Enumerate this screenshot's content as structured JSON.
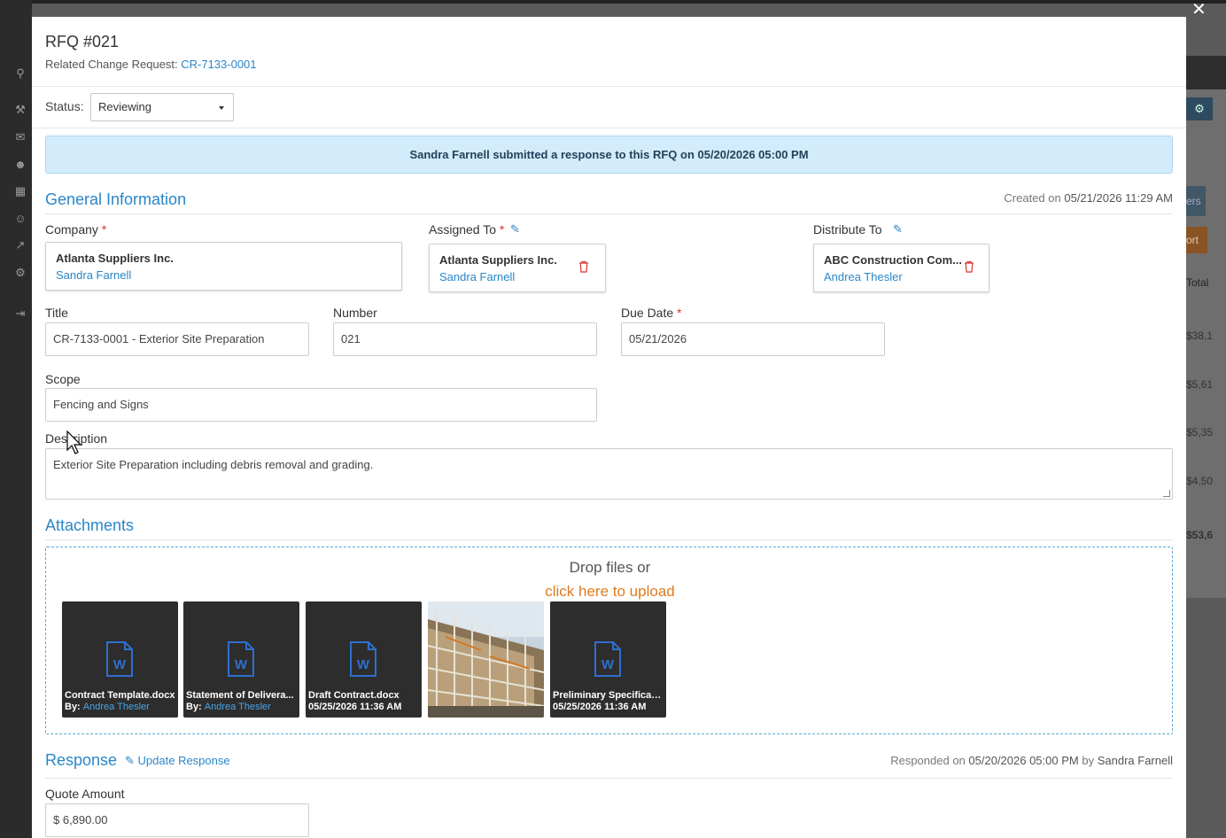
{
  "background": {
    "sidebar_icons": [
      "map-pin-icon",
      "hammer-icon",
      "mail-icon",
      "users-icon",
      "calendar-icon",
      "contacts-icon",
      "chart-icon",
      "gear-icon",
      "logout-icon"
    ],
    "right_fragments": {
      "button_partial_1": "ers",
      "button_partial_2": "ort",
      "column_header_partial": "Total",
      "cells": [
        "$38,1",
        "$5,61",
        "$5,35",
        "$4,50",
        "$53,6"
      ]
    }
  },
  "modal": {
    "title": "RFQ #021",
    "related_label": "Related Change Request:",
    "related_link": "CR-7133-0001",
    "status": {
      "label": "Status:",
      "value": "Reviewing"
    },
    "banner": "Sandra Farnell submitted a response to this RFQ on 05/20/2026 05:00 PM",
    "general": {
      "title": "General Information",
      "created_prefix": "Created on",
      "created_value": "05/21/2026 11:29 AM",
      "company": {
        "label": "Company",
        "required": "*",
        "name": "Atlanta Suppliers Inc.",
        "contact": "Sandra Farnell"
      },
      "assigned_to": {
        "label": "Assigned To",
        "required": "*",
        "name": "Atlanta Suppliers Inc.",
        "contact": "Sandra Farnell"
      },
      "distribute_to": {
        "label": "Distribute To",
        "name": "ABC Construction Com...",
        "contact": "Andrea Thesler"
      },
      "title_field": {
        "label": "Title",
        "value": "CR-7133-0001 - Exterior Site Preparation"
      },
      "number": {
        "label": "Number",
        "value": "021"
      },
      "due_date": {
        "label": "Due Date",
        "required": "*",
        "value": "05/21/2026"
      },
      "scope": {
        "label": "Scope",
        "value": "Fencing and Signs"
      },
      "description": {
        "label": "Description",
        "value": "Exterior Site Preparation including debris removal and grading."
      }
    },
    "attachments": {
      "title": "Attachments",
      "drop_text": "Drop files or",
      "upload_link": "click here to upload",
      "files": [
        {
          "name": "Contract Template.docx",
          "by_label": "By:",
          "by": "Andrea Thesler",
          "type": "word-doc-icon"
        },
        {
          "name": "Statement of Delivera...",
          "by_label": "By:",
          "by": "Andrea Thesler",
          "type": "word-doc-icon"
        },
        {
          "name": "Draft Contract.docx",
          "date": "05/25/2026 11:36 AM",
          "type": "word-doc-icon"
        },
        {
          "name": "",
          "type": "construction-photo"
        },
        {
          "name": "Preliminary Specificati...",
          "date": "05/25/2026 11:36 AM",
          "type": "word-doc-icon"
        }
      ]
    },
    "response": {
      "title": "Response",
      "update_label": "Update Response",
      "responded_prefix": "Responded on",
      "responded_date": "05/20/2026 05:00 PM",
      "by_label": "by",
      "responded_by": "Sandra Farnell",
      "quote_label": "Quote Amount",
      "quote_value": "$ 6,890.00"
    }
  },
  "colors": {
    "accent": "#2a86c8",
    "orange": "#e07a1f",
    "banner_bg": "#d3ecfb",
    "required": "#d9342b"
  }
}
